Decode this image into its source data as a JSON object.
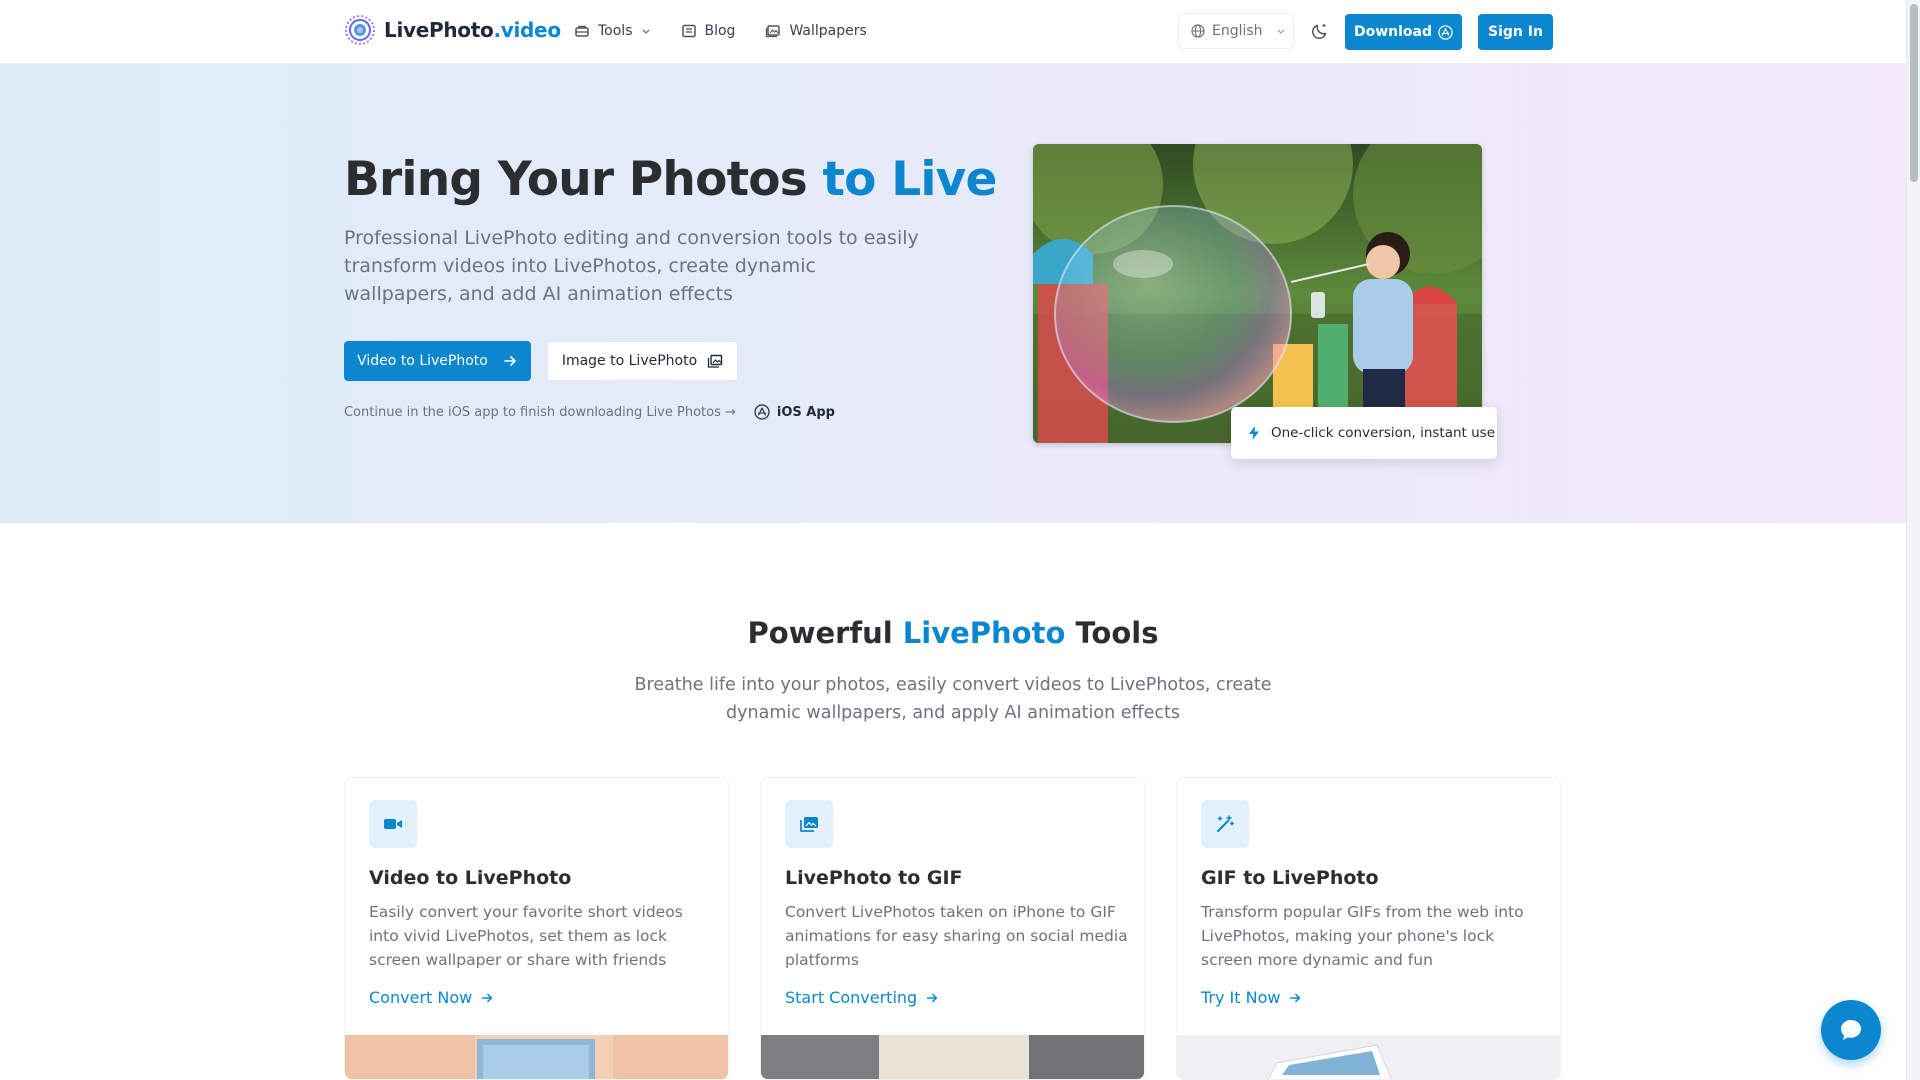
{
  "header": {
    "logo": {
      "brand": "LivePhoto",
      "tld": ".video",
      "icon": "aperture-logo-icon"
    },
    "nav": [
      {
        "label": "Tools",
        "icon": "tools-icon"
      },
      {
        "label": "Blog",
        "icon": "blog-icon"
      },
      {
        "label": "Wallpapers",
        "icon": "wallpapers-icon"
      }
    ],
    "language": "English",
    "download_label": "Download",
    "signin_label": "Sign In"
  },
  "hero": {
    "title_main": "Bring Your Photos ",
    "title_accent": "to Live",
    "subtitle": "Professional LivePhoto editing and conversion tools to easily transform videos into LivePhotos, create dynamic wallpapers, and add AI animation effects",
    "primary_cta": "Video to LivePhoto",
    "secondary_cta": "Image to LivePhoto",
    "ios_note": "Continue in the iOS app to finish downloading Live Photos →",
    "ios_app_label": "iOS App",
    "badge": "One-click conversion, instant use"
  },
  "tools": {
    "title_pre": "Powerful ",
    "title_accent": "LivePhoto",
    "title_post": " Tools",
    "subtitle": "Breathe life into your photos, easily convert videos to LivePhotos, create dynamic wallpapers, and apply AI animation effects",
    "cards": [
      {
        "title": "Video to LivePhoto",
        "desc": "Easily convert your favorite short videos into vivid LivePhotos, set them as lock screen wallpaper or share with friends",
        "link": "Convert Now",
        "icon": "video-camera-icon"
      },
      {
        "title": "LivePhoto to GIF",
        "desc": "Convert LivePhotos taken on iPhone to GIF animations for easy sharing on social media platforms",
        "link": "Start Converting",
        "icon": "images-icon"
      },
      {
        "title": "GIF to LivePhoto",
        "desc": "Transform popular GIFs from the web into LivePhotos, making your phone's lock screen more dynamic and fun",
        "link": "Try It Now",
        "icon": "magic-wand-icon"
      }
    ]
  },
  "colors": {
    "accent": "#0a87cf",
    "text": "#2b2d31",
    "muted": "#6b7280"
  }
}
